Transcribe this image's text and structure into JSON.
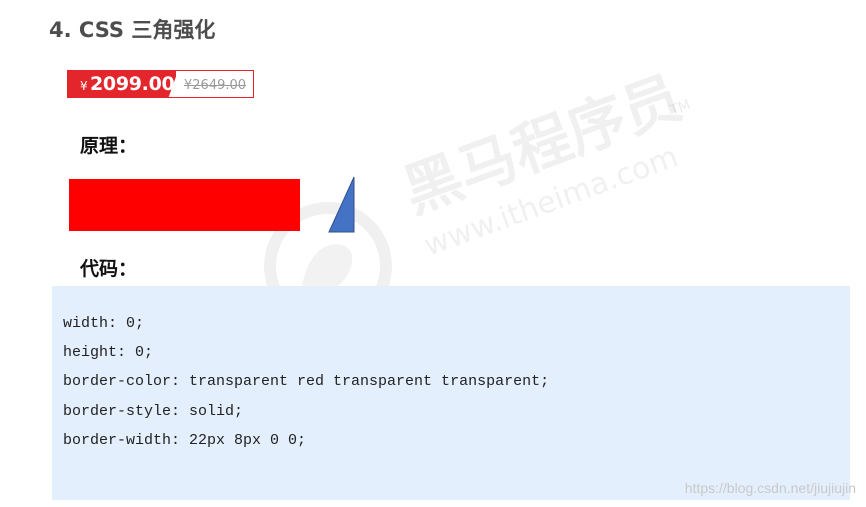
{
  "heading": "4. CSS 三角强化",
  "price": {
    "currency": "¥",
    "current": "2099.00",
    "original": "¥2649.00"
  },
  "labels": {
    "principle": "原理：",
    "code": "代码："
  },
  "code_lines": [
    "width: 0;",
    "height: 0;",
    "border-color: transparent red transparent transparent;",
    "border-style: solid;",
    "border-width: 22px 8px 0 0;"
  ],
  "watermark": {
    "brand": "黑马程序员",
    "trademark": "TM",
    "url": "www.itheima.com"
  },
  "source_url": "https://blog.csdn.net/jiujiujin",
  "colors": {
    "price_red": "#e3262b",
    "demo_rect": "#ff0000",
    "demo_triangle": "#4472c4",
    "code_bg": "#e4effd"
  }
}
